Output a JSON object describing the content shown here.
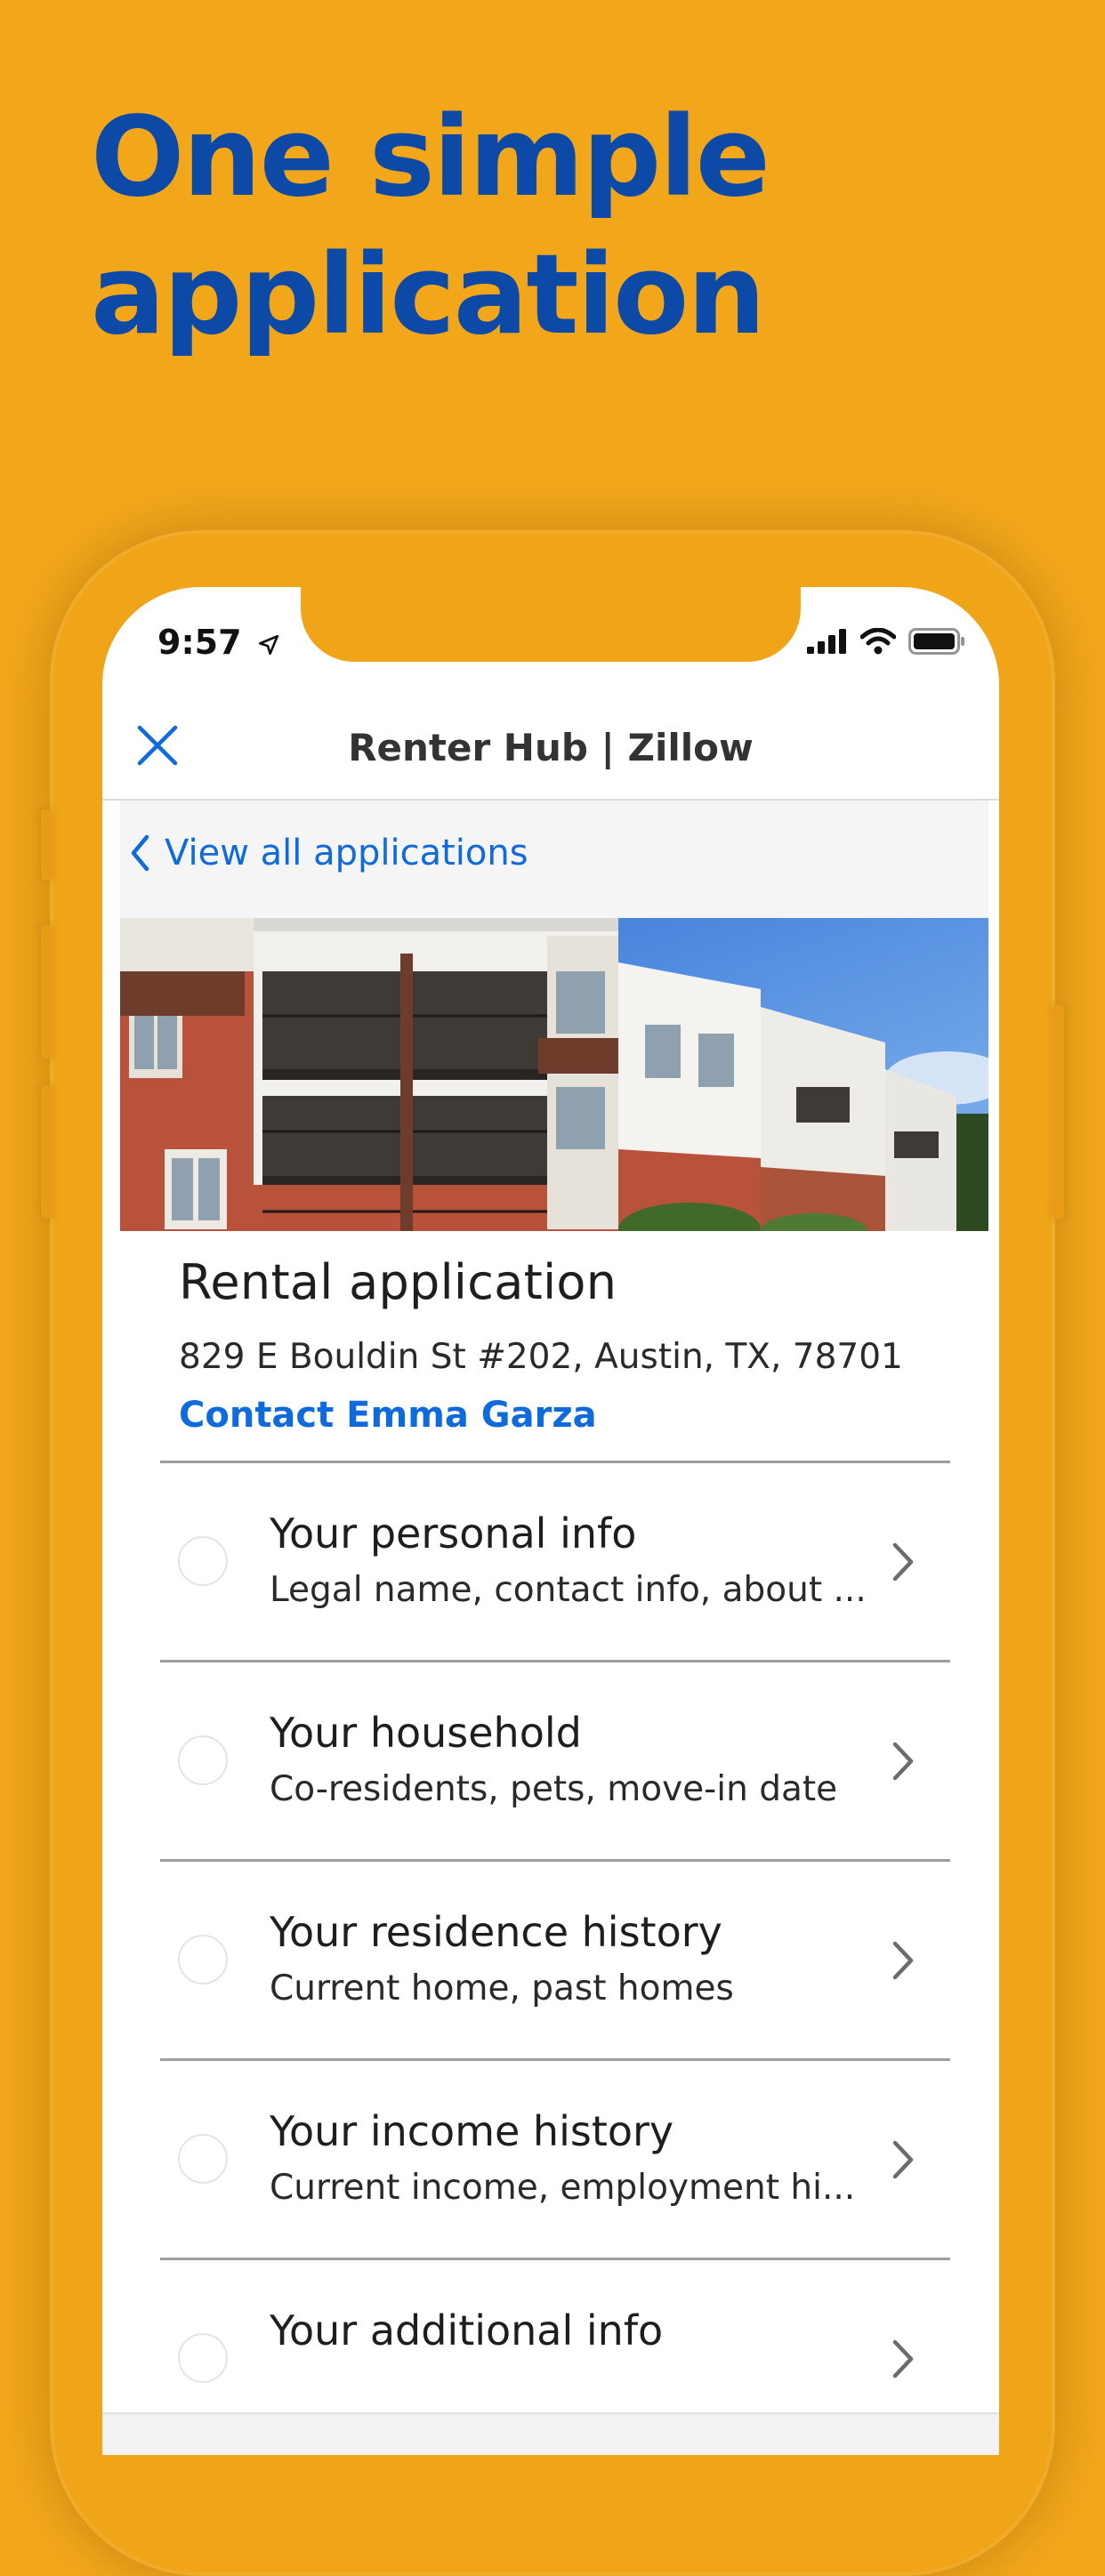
{
  "headline": {
    "line1": "One simple",
    "line2": "application"
  },
  "status_bar": {
    "time": "9:57",
    "icons": [
      "location-arrow-icon",
      "signal-icon",
      "wifi-icon",
      "battery-icon"
    ]
  },
  "nav": {
    "title": "Renter Hub | Zillow",
    "close_icon": "close-icon"
  },
  "back_link": {
    "label": "View all applications",
    "icon": "chevron-left-icon"
  },
  "hero_image": "apartment-building-photo",
  "application": {
    "title": "Rental application",
    "address": "829 E Bouldin St #202, Austin, TX, 78701",
    "contact_label": "Contact Emma Garza"
  },
  "sections": [
    {
      "title": "Your personal info",
      "subtitle": "Legal name, contact info, about ..."
    },
    {
      "title": "Your household",
      "subtitle": "Co-residents, pets, move-in date"
    },
    {
      "title": "Your residence history",
      "subtitle": "Current home, past homes"
    },
    {
      "title": "Your income history",
      "subtitle": "Current income, employment hi..."
    },
    {
      "title": "Your additional info",
      "subtitle": ""
    }
  ],
  "colors": {
    "background": "#F2A71B",
    "headline": "#0D4AA8",
    "link": "#0F6ADB",
    "divider": "#9E9E9E"
  }
}
